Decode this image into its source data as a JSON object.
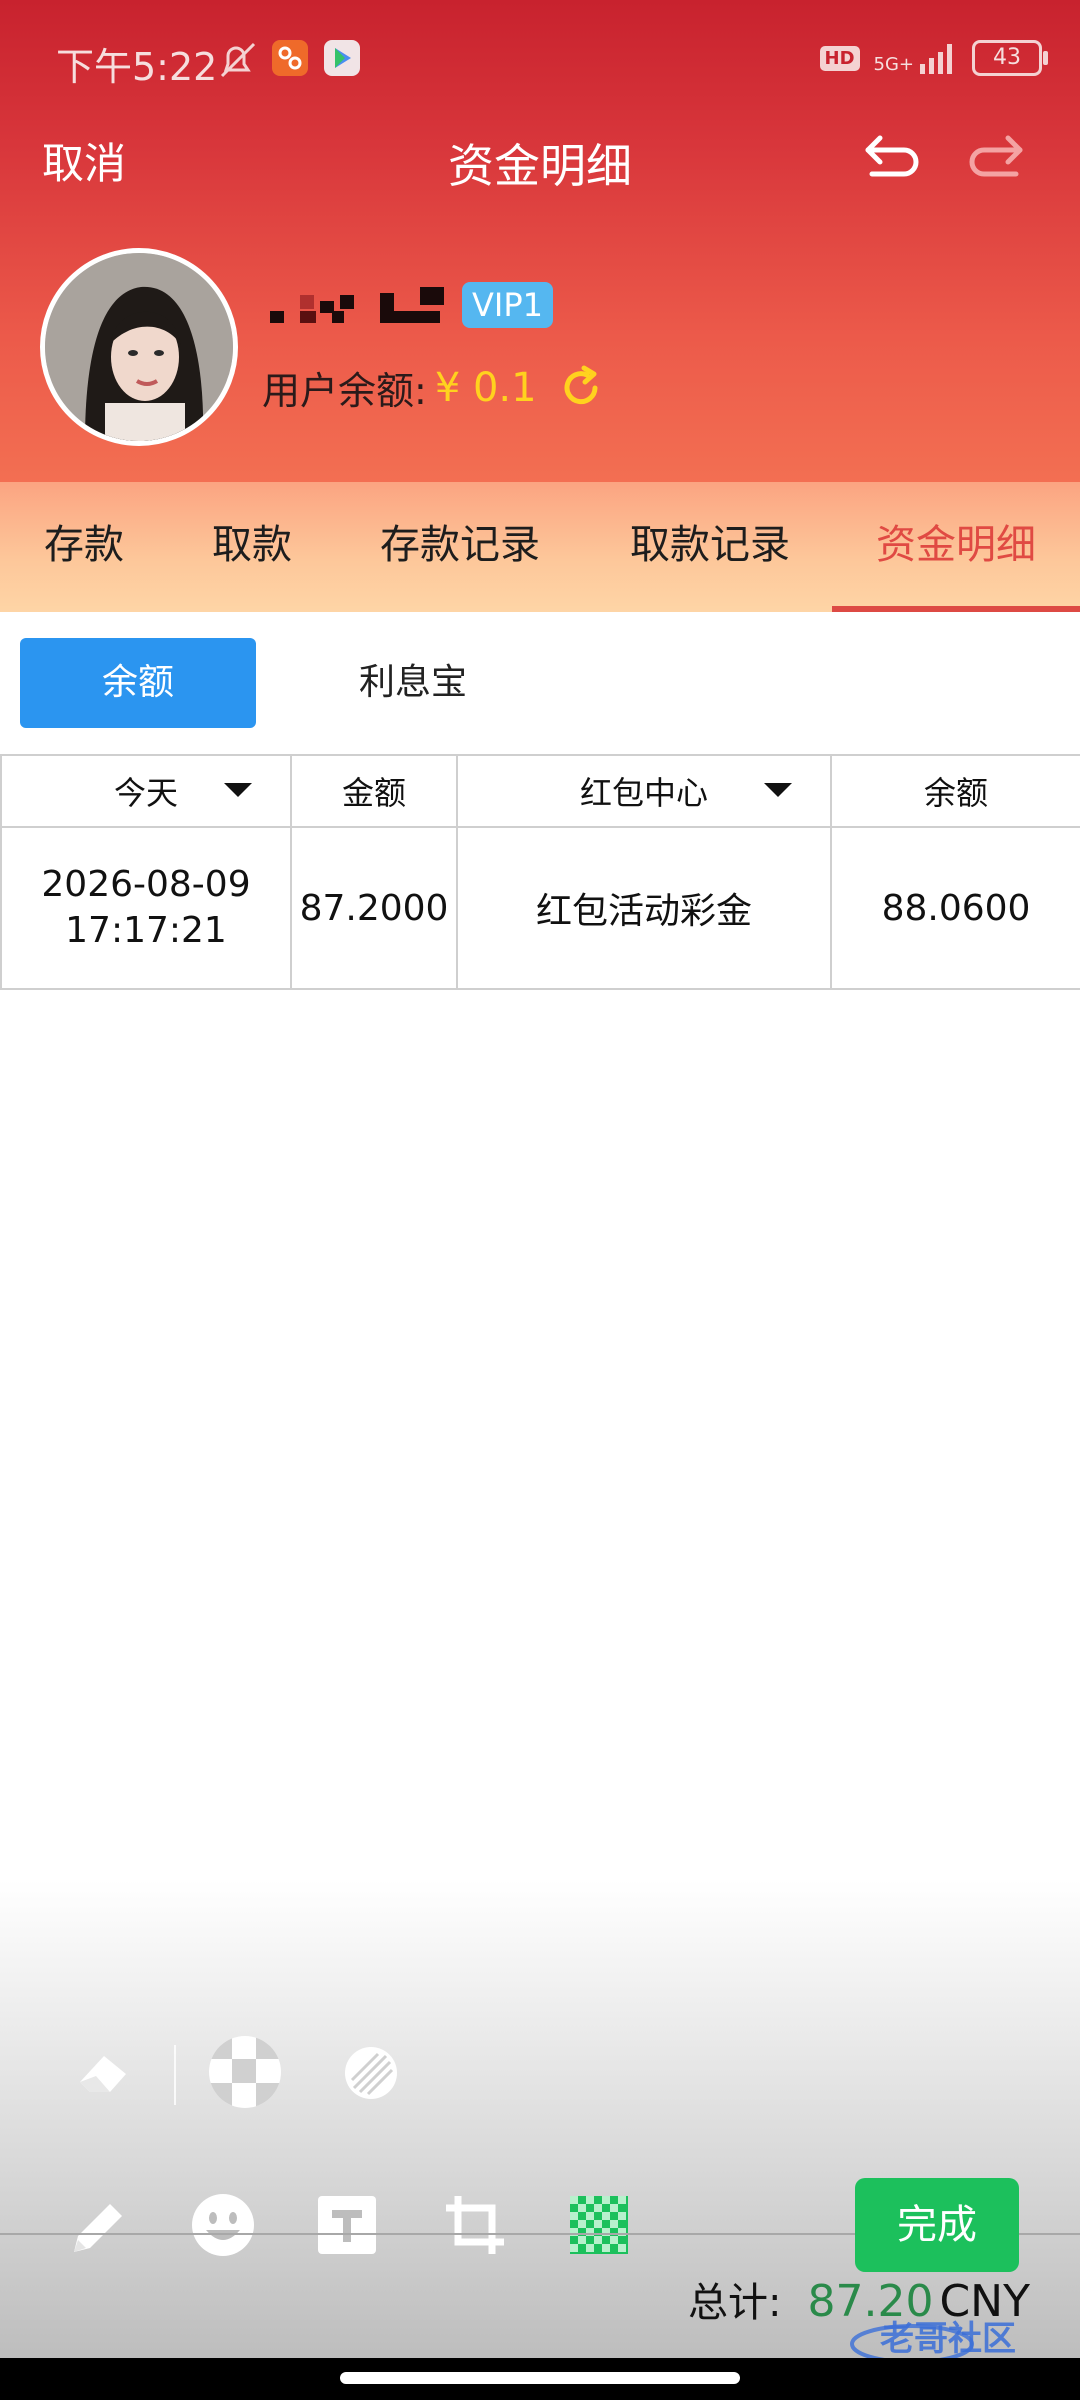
{
  "status_bar": {
    "time": "下午5:22",
    "hd_label": "HD",
    "network_label": "5G+",
    "battery_level": "43"
  },
  "nav": {
    "cancel_label": "取消",
    "title": "资金明细"
  },
  "user": {
    "vip_label": "VIP1",
    "balance_label": "用户余额:",
    "balance_value": "¥ 0.1"
  },
  "tabs": [
    {
      "label": "存款",
      "active": false
    },
    {
      "label": "取款",
      "active": false
    },
    {
      "label": "存款记录",
      "active": false
    },
    {
      "label": "取款记录",
      "active": false
    },
    {
      "label": "资金明细",
      "active": true
    }
  ],
  "sub_tabs": {
    "balance": "余额",
    "interest": "利息宝"
  },
  "table": {
    "headers": {
      "date_filter": "今天",
      "amount": "金额",
      "type_filter": "红包中心",
      "balance": "余额"
    },
    "rows": [
      {
        "date": "2026-08-09",
        "time": "17:17:21",
        "amount": "87.2000",
        "type": "红包活动彩金",
        "balance": "88.0600"
      }
    ]
  },
  "editor": {
    "tools_top": [
      "eraser-icon",
      "mosaic-circle-icon",
      "blur-circle-icon"
    ],
    "tools_bottom": [
      "pencil-icon",
      "emoji-icon",
      "text-icon",
      "crop-icon",
      "mosaic-icon"
    ],
    "done_label": "完成"
  },
  "footer": {
    "total_label": "总计:",
    "total_value": "87.20",
    "currency": "CNY"
  },
  "watermark_text": "老哥社区",
  "colors": {
    "header_red": "#c8222e",
    "active_tab": "#e04a43",
    "primary_blue": "#2b95f0",
    "done_green": "#1cc05c",
    "balance_yellow": "#ffd21e"
  }
}
